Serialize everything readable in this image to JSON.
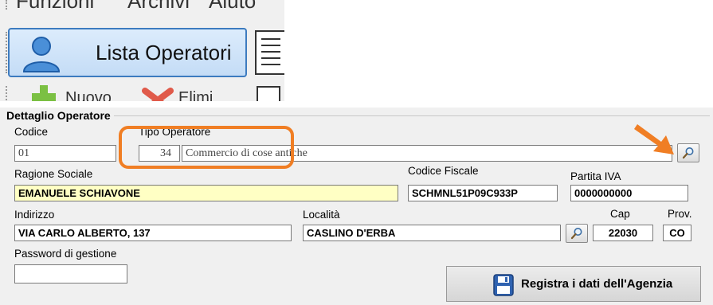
{
  "toolbar": {
    "menu": [
      "Funzioni",
      "Archivi",
      "Aiuto"
    ],
    "lista_operatori_label": "Lista Operatori",
    "partial_labels": [
      "Nuovo",
      "Elimi"
    ]
  },
  "form": {
    "section_title": "Dettaglio Operatore",
    "codice": {
      "label": "Codice",
      "value": "01"
    },
    "tipo_operatore": {
      "label": "Tipo Operatore",
      "code": "34",
      "description": "Commercio di cose antiche"
    },
    "ragione_sociale": {
      "label": "Ragione Sociale",
      "value": "EMANUELE SCHIAVONE"
    },
    "codice_fiscale": {
      "label": "Codice Fiscale",
      "value": "SCHMNL51P09C933P"
    },
    "partita_iva": {
      "label": "Partita IVA",
      "value": "0000000000"
    },
    "indirizzo": {
      "label": "Indirizzo",
      "value": "VIA CARLO ALBERTO, 137"
    },
    "localita": {
      "label": "Località",
      "value": "CASLINO D'ERBA"
    },
    "cap": {
      "label": "Cap",
      "value": "22030"
    },
    "prov": {
      "label": "Prov.",
      "value": "CO"
    },
    "password": {
      "label": "Password di gestione",
      "value": ""
    },
    "save_label": "Registra i dati dell'Agenzia"
  },
  "colors": {
    "annotation": "#f07e24",
    "highlight_field": "#ffffc4",
    "selected_button": "#3d7bbf"
  },
  "icons": [
    "user-icon",
    "list-icon",
    "plus-icon",
    "delete-icon",
    "search-icon",
    "save-disk-icon",
    "arrow-annotation"
  ]
}
